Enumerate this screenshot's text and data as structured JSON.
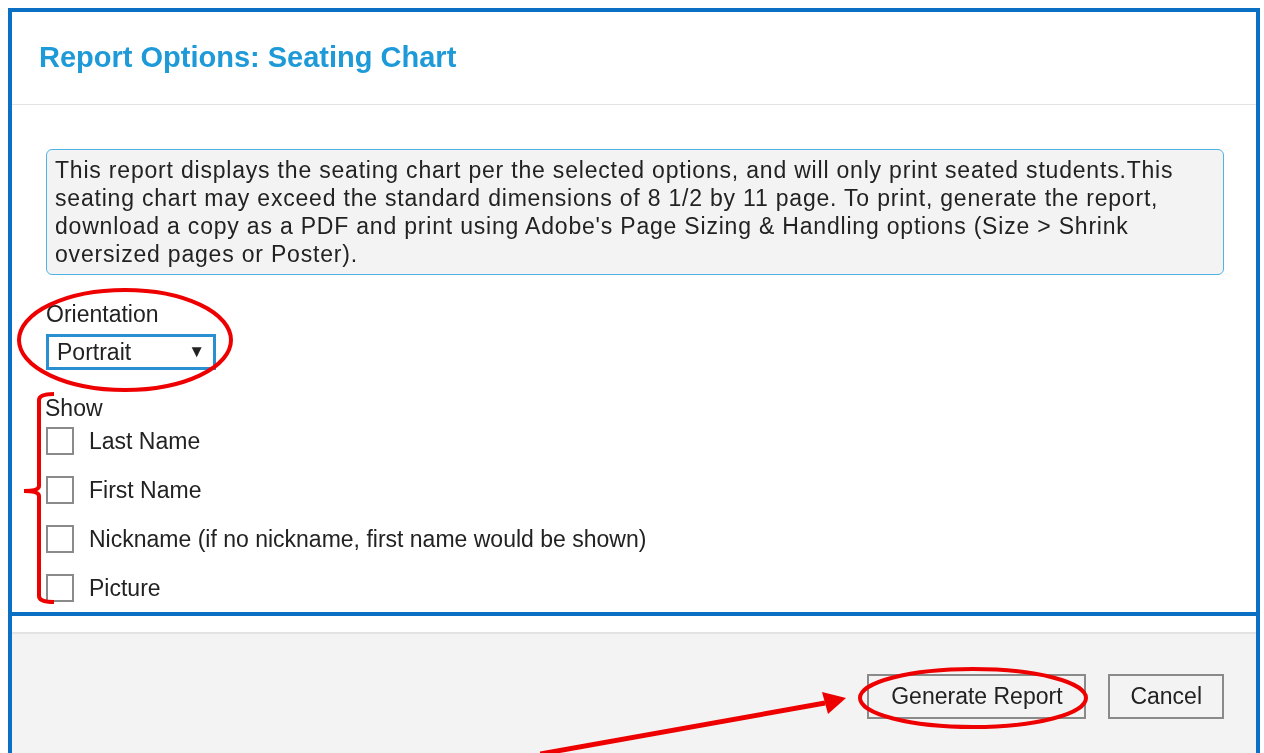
{
  "dialog": {
    "title": "Report Options: Seating Chart",
    "notice": "This report displays the seating chart per the selected options, and will only print seated students.This seating chart may exceed the standard dimensions of 8 1/2 by 11 page. To print, generate the report, download a copy as a PDF and print using Adobe's Page Sizing & Handling options (Size > Shrink oversized pages or Poster).",
    "orientation": {
      "label": "Orientation",
      "value": "Portrait",
      "arrow": "▼"
    },
    "show": {
      "label": "Show",
      "options": [
        {
          "label": "Last Name",
          "checked": false
        },
        {
          "label": "First Name",
          "checked": false
        },
        {
          "label": "Nickname (if no nickname, first name would be shown)",
          "checked": false
        },
        {
          "label": "Picture",
          "checked": false
        }
      ]
    },
    "buttons": [
      {
        "label": "Generate Report"
      },
      {
        "label": "Cancel"
      }
    ]
  }
}
